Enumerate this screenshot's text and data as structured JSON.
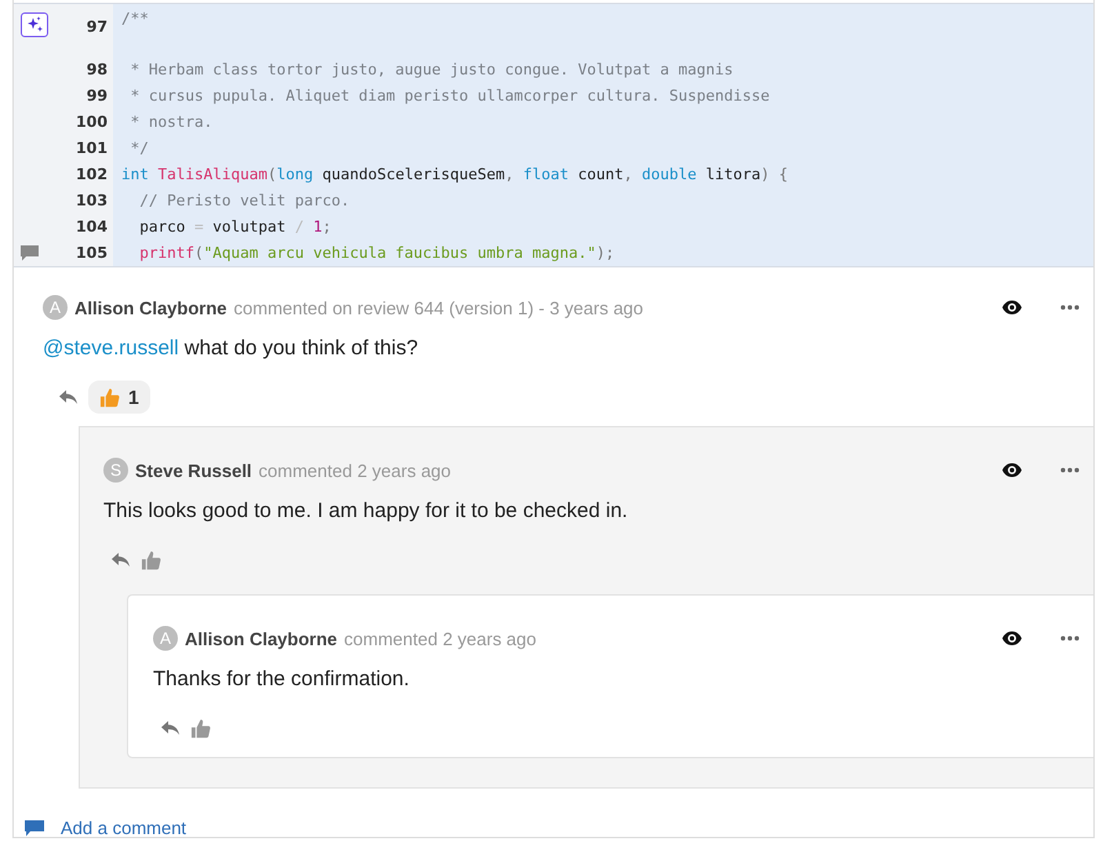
{
  "code": {
    "lines": [
      {
        "number": "97",
        "tokens": [
          {
            "kind": "comment",
            "text": "/**"
          }
        ]
      },
      {
        "number": "98",
        "tokens": [
          {
            "kind": "comment",
            "text": " * Herbam class tortor justo, augue justo congue. Volutpat a magnis"
          }
        ]
      },
      {
        "number": "99",
        "tokens": [
          {
            "kind": "comment",
            "text": " * cursus pupula. Aliquet diam peristo ullamcorper cultura. Suspendisse"
          }
        ]
      },
      {
        "number": "100",
        "tokens": [
          {
            "kind": "comment",
            "text": " * nostra."
          }
        ]
      },
      {
        "number": "101",
        "tokens": [
          {
            "kind": "comment",
            "text": " */"
          }
        ]
      },
      {
        "number": "102",
        "tokens": [
          {
            "kind": "type",
            "text": "int"
          },
          {
            "kind": "func",
            "text": " TalisAliquam"
          },
          {
            "kind": "punct",
            "text": "("
          },
          {
            "kind": "type",
            "text": "long"
          },
          {
            "kind": "plain",
            "text": " quandoScelerisqueSem"
          },
          {
            "kind": "punct",
            "text": ", "
          },
          {
            "kind": "type",
            "text": "float"
          },
          {
            "kind": "plain",
            "text": " count"
          },
          {
            "kind": "punct",
            "text": ", "
          },
          {
            "kind": "type",
            "text": "double"
          },
          {
            "kind": "plain",
            "text": " litora"
          },
          {
            "kind": "punct",
            "text": ") {"
          }
        ]
      },
      {
        "number": "103",
        "tokens": [
          {
            "kind": "comment",
            "text": "  // Peristo velit parco."
          }
        ]
      },
      {
        "number": "104",
        "tokens": [
          {
            "kind": "plain",
            "text": "  parco "
          },
          {
            "kind": "op",
            "text": "="
          },
          {
            "kind": "plain",
            "text": " volutpat "
          },
          {
            "kind": "op",
            "text": "/"
          },
          {
            "kind": "num",
            "text": " 1"
          },
          {
            "kind": "punct",
            "text": ";"
          }
        ]
      },
      {
        "number": "105",
        "tokens": [
          {
            "kind": "func",
            "text": "  printf"
          },
          {
            "kind": "punct",
            "text": "("
          },
          {
            "kind": "str",
            "text": "\"Aquam arcu vehicula faucibus umbra magna.\""
          },
          {
            "kind": "punct",
            "text": ");"
          }
        ]
      }
    ]
  },
  "comments": [
    {
      "avatar": "A",
      "author": "Allison Clayborne",
      "meta": "commented on review 644 (version 1) - 3 years ago",
      "mention": "@steve.russell",
      "body": "what do you think of this?",
      "like_count": "1",
      "replies": [
        {
          "avatar": "S",
          "author": "Steve Russell",
          "meta": "commented 2 years ago",
          "body": "This looks good to me. I am happy for it to be checked in.",
          "replies": [
            {
              "avatar": "A",
              "author": "Allison Clayborne",
              "meta": "commented 2 years ago",
              "body": "Thanks for the confirmation."
            }
          ]
        }
      ]
    }
  ],
  "add_comment": "Add a comment"
}
